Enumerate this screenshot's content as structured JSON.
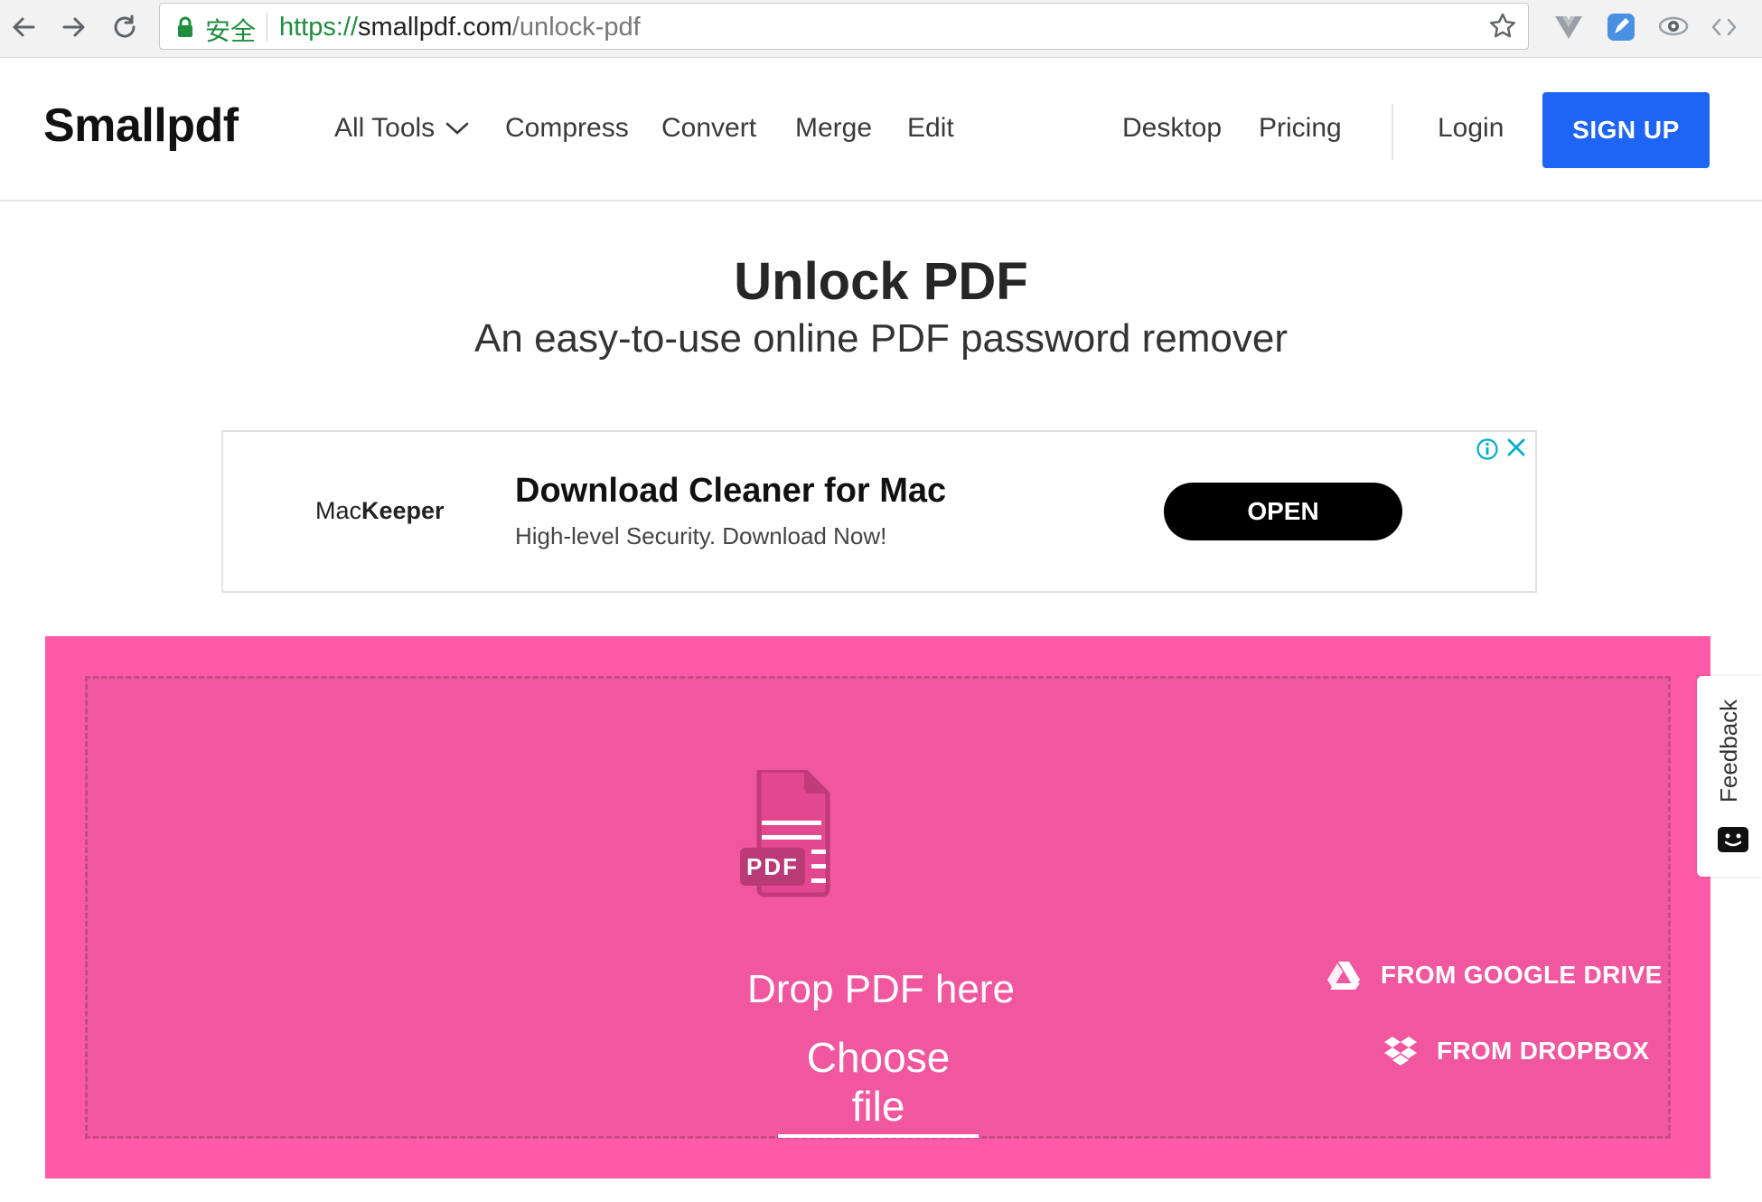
{
  "browser": {
    "secure_label": "安全",
    "url_scheme": "https://",
    "url_host": "smallpdf.com",
    "url_path": "/unlock-pdf"
  },
  "header": {
    "logo": "Smallpdf",
    "nav": {
      "all_tools": "All Tools",
      "compress": "Compress",
      "convert": "Convert",
      "merge": "Merge",
      "edit": "Edit",
      "desktop": "Desktop",
      "pricing": "Pricing",
      "login": "Login",
      "signup": "SIGN UP"
    },
    "signup_color": "#1e64f5"
  },
  "hero": {
    "title": "Unlock PDF",
    "subtitle": "An easy-to-use online PDF password remover"
  },
  "ad": {
    "brand_prefix": "Mac",
    "brand_bold": "Keeper",
    "headline": "Download Cleaner for Mac",
    "description": "High-level Security. Download Now!",
    "cta": "OPEN"
  },
  "dropzone": {
    "color": "#ff5aa8",
    "icon_label": "PDF",
    "drop_text": "Drop PDF here",
    "choose_file": "Choose file",
    "google_drive": "FROM GOOGLE DRIVE",
    "dropbox": "FROM DROPBOX"
  },
  "feedback": {
    "label": "Feedback"
  }
}
